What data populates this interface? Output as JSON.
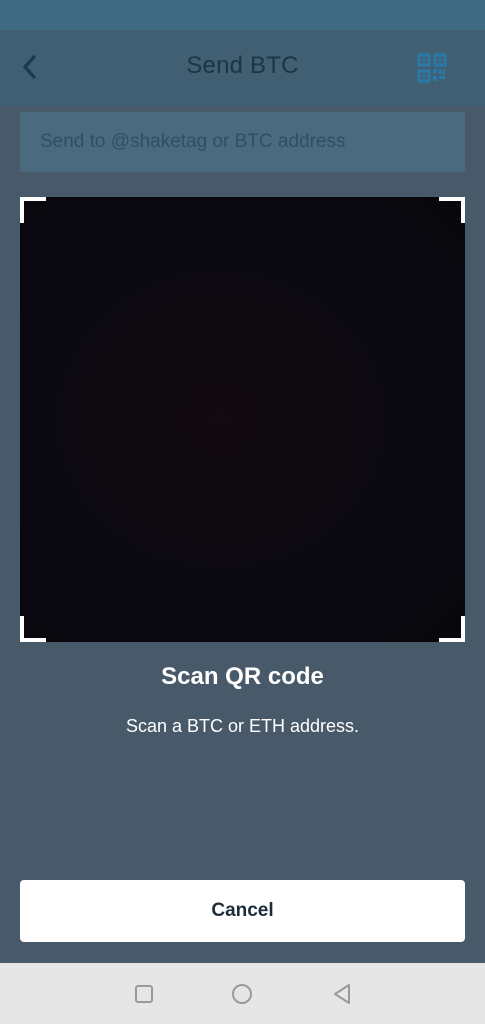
{
  "header": {
    "title": "Send BTC",
    "back_icon": "chevron-left-icon",
    "qr_icon": "qr-code-icon"
  },
  "search": {
    "placeholder": "Send to @shaketag or BTC address",
    "value": ""
  },
  "scanner": {
    "title": "Scan QR code",
    "subtitle": "Scan a BTC or ETH address."
  },
  "actions": {
    "cancel_label": "Cancel"
  },
  "system_nav": {
    "recents_icon": "square-icon",
    "home_icon": "circle-icon",
    "back_icon": "triangle-back-icon"
  },
  "colors": {
    "overlay": "#485a69",
    "accent": "#2a78a8",
    "title_text": "#1b3446",
    "button_text": "#1d2c3b"
  }
}
